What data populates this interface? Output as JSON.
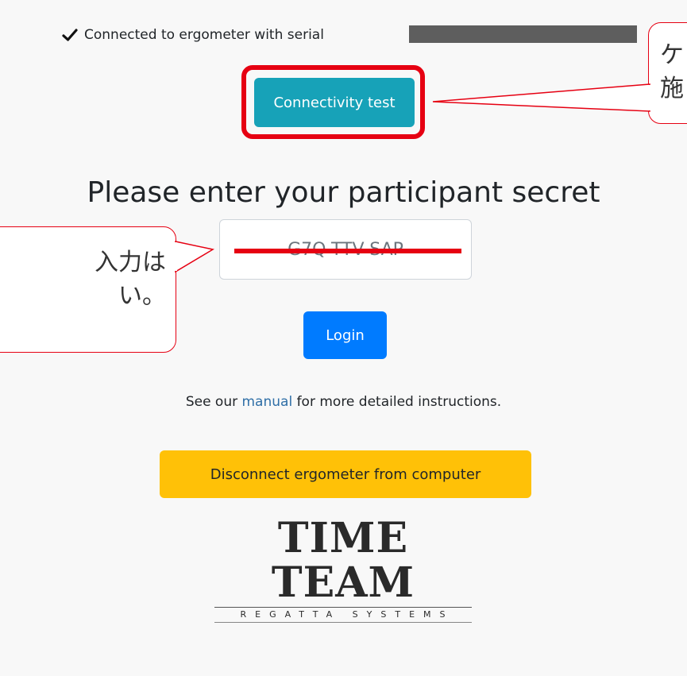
{
  "status": {
    "check_icon": "check-icon",
    "text": "Connected to ergometer with serial"
  },
  "buttons": {
    "connectivity_label": "Connectivity test",
    "login_label": "Login",
    "disconnect_label": "Disconnect ergometer from computer"
  },
  "heading": "Please enter your participant secret",
  "secret_input": {
    "value": "G7Q-TTV-SAP"
  },
  "manual": {
    "prefix": "See our ",
    "link": "manual",
    "suffix": " for more detailed instructions."
  },
  "logo": {
    "main": "TIME TEAM",
    "sub": "REGATTA SYSTEMS"
  },
  "annotations": {
    "right_callout_line1": "ケ",
    "right_callout_line2": "施",
    "left_callout_line1": "入力は",
    "left_callout_line2": "い。"
  },
  "colors": {
    "connectivity": "#17a2b8",
    "login": "#007bff",
    "disconnect": "#ffc107",
    "annotation_red": "#e60012"
  }
}
